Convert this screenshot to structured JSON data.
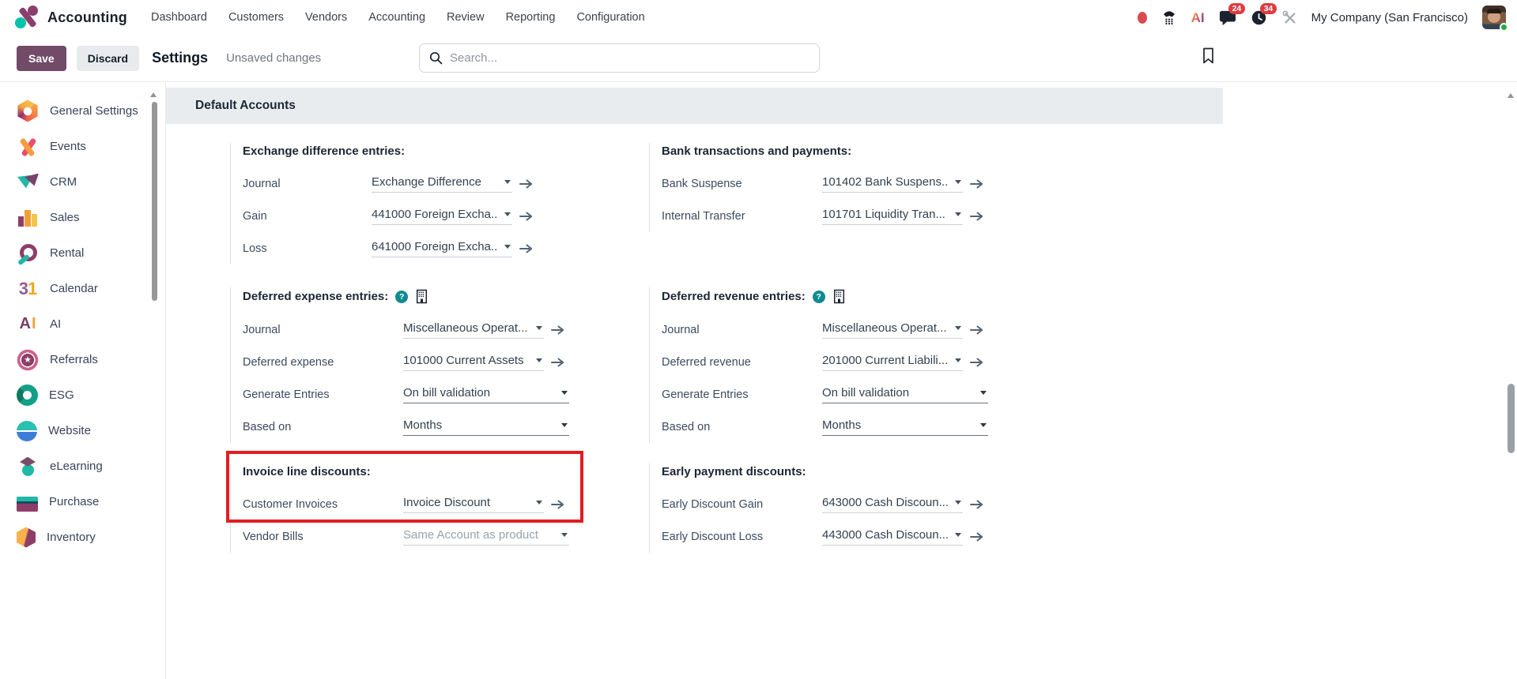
{
  "topbar": {
    "app_name": "Accounting",
    "menu": [
      "Dashboard",
      "Customers",
      "Vendors",
      "Accounting",
      "Review",
      "Reporting",
      "Configuration"
    ],
    "message_badge": "24",
    "activity_badge": "34",
    "company": "My Company (San Francisco)"
  },
  "control_bar": {
    "save_label": "Save",
    "discard_label": "Discard",
    "title": "Settings",
    "unsaved": "Unsaved changes",
    "search_placeholder": "Search..."
  },
  "sidebar": {
    "items": [
      {
        "label": "General Settings",
        "icon": "general-settings-icon"
      },
      {
        "label": "Events",
        "icon": "events-icon"
      },
      {
        "label": "CRM",
        "icon": "crm-icon"
      },
      {
        "label": "Sales",
        "icon": "sales-icon"
      },
      {
        "label": "Rental",
        "icon": "rental-icon"
      },
      {
        "label": "Calendar",
        "icon": "calendar-icon"
      },
      {
        "label": "AI",
        "icon": "ai-icon"
      },
      {
        "label": "Referrals",
        "icon": "referrals-icon"
      },
      {
        "label": "ESG",
        "icon": "esg-icon"
      },
      {
        "label": "Website",
        "icon": "website-icon"
      },
      {
        "label": "eLearning",
        "icon": "elearning-icon"
      },
      {
        "label": "Purchase",
        "icon": "purchase-icon"
      },
      {
        "label": "Inventory",
        "icon": "inventory-icon"
      }
    ]
  },
  "content": {
    "header": "Default Accounts",
    "columns": {
      "left": [
        {
          "title": "Exchange difference entries:",
          "rows": [
            {
              "label": "Journal",
              "value": "Exchange Difference",
              "type": "m2o",
              "arrow": true
            },
            {
              "label": "Gain",
              "value": "441000 Foreign Excha...",
              "type": "m2o",
              "arrow": true
            },
            {
              "label": "Loss",
              "value": "641000 Foreign Excha...",
              "type": "m2o",
              "arrow": true
            }
          ]
        },
        {
          "title": "Deferred expense entries:",
          "icons": [
            "help-icon",
            "building-icon"
          ],
          "rows": [
            {
              "label": "Journal",
              "value": "Miscellaneous Operat...",
              "type": "m2o",
              "arrow": true
            },
            {
              "label": "Deferred expense",
              "value": "101000 Current Assets",
              "type": "m2o",
              "arrow": true
            },
            {
              "label": "Generate Entries",
              "value": "On bill validation",
              "type": "select"
            },
            {
              "label": "Based on",
              "value": "Months",
              "type": "select"
            }
          ]
        },
        {
          "title": "Invoice line discounts:",
          "highlight": true,
          "rows": [
            {
              "label": "Customer Invoices",
              "value": "Invoice Discount",
              "type": "m2o",
              "arrow": true
            },
            {
              "label": "Vendor Bills",
              "value": "Same Account as product",
              "type": "m2o",
              "muted": true,
              "wide": true,
              "arrow": false
            }
          ]
        }
      ],
      "right": [
        {
          "title": "Bank transactions and payments:",
          "rows": [
            {
              "label": "Bank Suspense",
              "value": "101402 Bank Suspens...",
              "type": "m2o",
              "arrow": true
            },
            {
              "label": "Internal Transfer",
              "value": "101701 Liquidity Tran...",
              "type": "m2o",
              "arrow": true
            }
          ]
        },
        {
          "title": "Deferred revenue entries:",
          "icons": [
            "help-icon",
            "building-icon"
          ],
          "rows": [
            {
              "label": "Journal",
              "value": "Miscellaneous Operat...",
              "type": "m2o",
              "arrow": true
            },
            {
              "label": "Deferred revenue",
              "value": "201000 Current Liabili...",
              "type": "m2o",
              "arrow": true
            },
            {
              "label": "Generate Entries",
              "value": "On bill validation",
              "type": "select"
            },
            {
              "label": "Based on",
              "value": "Months",
              "type": "select"
            }
          ]
        },
        {
          "title": "Early payment discounts:",
          "rows": [
            {
              "label": "Early Discount Gain",
              "value": "643000 Cash Discoun...",
              "type": "m2o",
              "arrow": true
            },
            {
              "label": "Early Discount Loss",
              "value": "443000 Cash Discoun...",
              "type": "m2o",
              "arrow": true
            }
          ]
        }
      ]
    }
  },
  "icons": {
    "accounting-app-logo-icon": "percent-mark",
    "record-indicator-icon": "red-dot",
    "phone-icon": "handset-keypad",
    "ai-icon": "AI",
    "messages-icon": "chat-bubble",
    "activities-icon": "clock",
    "tools-icon": "crossed-tools",
    "search-icon": "magnifier",
    "bookmark-icon": "bookmark-outline",
    "help-icon": "?",
    "building-icon": "building",
    "chevron-down-icon": "▾",
    "internal-link-arrow-icon": "→",
    "calendar-icon-glyph": "31",
    "referrals-icon-glyph": "★"
  },
  "colors": {
    "accent": "#714B67",
    "highlight_red": "#e11d21",
    "badge_red": "#dc3c41",
    "help_teal": "#0d8b90",
    "header_bar_gray": "#e9ecef"
  }
}
